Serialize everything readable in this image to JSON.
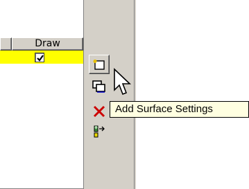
{
  "table": {
    "columns": [
      "",
      "Draw"
    ],
    "rows": [
      {
        "draw_checked": true,
        "selected": true
      }
    ]
  },
  "toolbar": {
    "buttons": [
      {
        "name": "add-surface-settings-button",
        "icon": "add-surface-settings-icon"
      },
      {
        "name": "copy-surface-settings-button",
        "icon": "copy-icon"
      },
      {
        "name": "delete-surface-settings-button",
        "icon": "delete-x-icon"
      },
      {
        "name": "import-surface-settings-button",
        "icon": "import-icon"
      }
    ]
  },
  "tooltip": {
    "text": "Add Surface Settings"
  },
  "colors": {
    "panel_bg": "#d4d0c8",
    "selected_row": "#ffff00",
    "tooltip_bg": "#ffffe1",
    "delete_red": "#cc0000"
  }
}
